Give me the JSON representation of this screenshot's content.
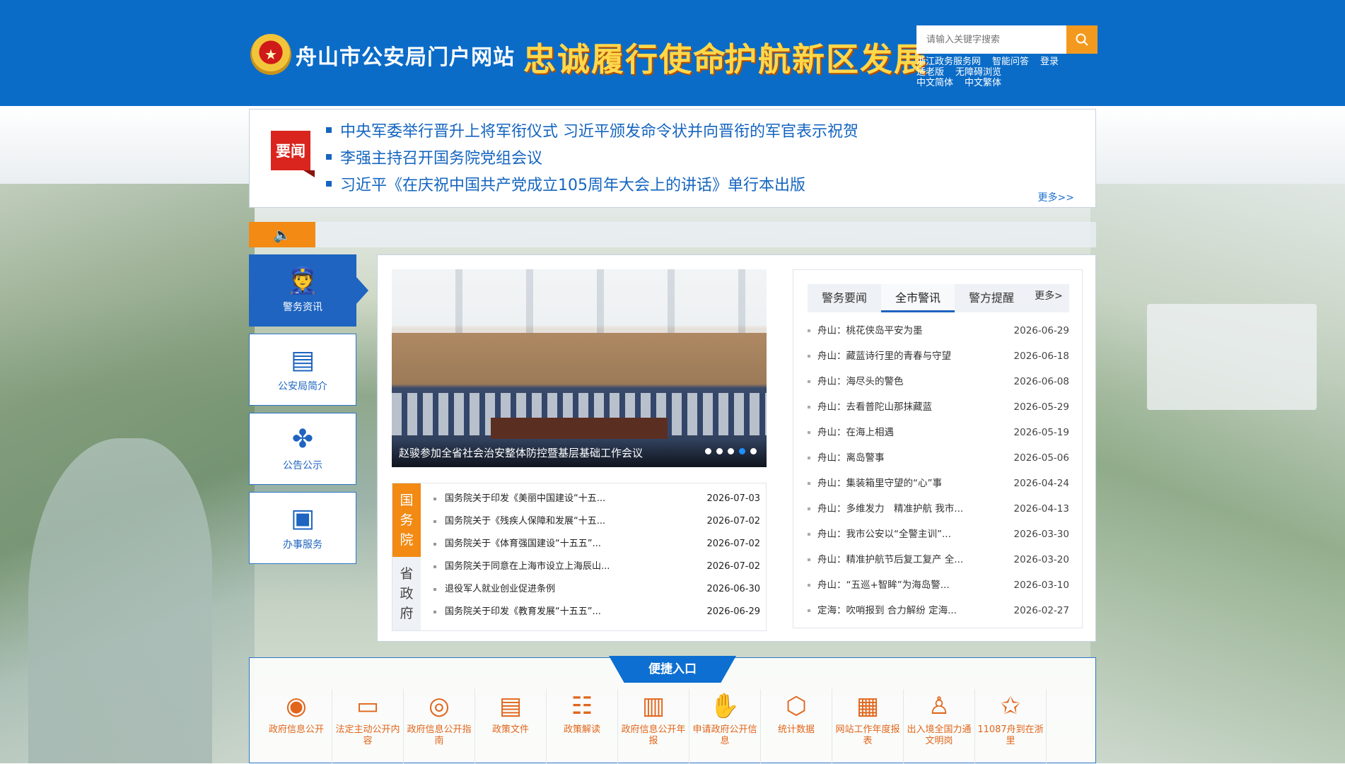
{
  "header": {
    "emblem_glyph": "★",
    "site_title": "舟山市公安局门户网站",
    "slogan_left": "忠诚履行使命",
    "slogan_right": "护航新区发展",
    "search_placeholder": "请输入关键字搜索",
    "search_icon": "magnifier-icon",
    "links": [
      "浙江政务服务网",
      "智能问答",
      "登录",
      "适老版",
      "无障碍浏览",
      "中文简体",
      "中文繁体"
    ]
  },
  "headline_news": {
    "tag": "要闻",
    "items": [
      "中央军委举行晋升上将军衔仪式 习近平颁发命令状并向晋衔的军官表示祝贺",
      "李强主持召开国务院党组会议",
      "习近平《在庆祝中国共产党成立105周年大会上的讲话》单行本出版"
    ],
    "more": "更多>>"
  },
  "notice": {
    "icon": "speaker-icon",
    "glyph": "🔈"
  },
  "side_nav": [
    {
      "label": "警务资讯",
      "glyph": "👮"
    },
    {
      "label": "公安局简介",
      "glyph": "▤"
    },
    {
      "label": "公告公示",
      "glyph": "✤"
    },
    {
      "label": "办事服务",
      "glyph": "▣"
    }
  ],
  "carousel": {
    "caption": "赵骏参加全省社会治安整体防控暨基层基础工作会议",
    "slide_count": 5,
    "active_index": 3
  },
  "gov_docs": {
    "tab_state_council": "国务院",
    "tab_province": "省政府",
    "items": [
      {
        "title": "国务院关于印发《美丽中国建设“十五...",
        "date": "2026-07-03"
      },
      {
        "title": "国务院关于《残疾人保障和发展“十五...",
        "date": "2026-07-02"
      },
      {
        "title": "国务院关于《体育强国建设“十五五”...",
        "date": "2026-07-02"
      },
      {
        "title": "国务院关于同意在上海市设立上海辰山...",
        "date": "2026-07-02"
      },
      {
        "title": "退役军人就业创业促进条例",
        "date": "2026-06-30"
      },
      {
        "title": "国务院关于印发《教育发展“十五五”...",
        "date": "2026-06-29"
      }
    ]
  },
  "police_news": {
    "tabs": [
      "警务要闻",
      "全市警讯",
      "警方提醒"
    ],
    "active_tab": 1,
    "more": "更多>",
    "items": [
      {
        "title": "舟山：桃花侠岛平安为墨",
        "date": "2026-06-29"
      },
      {
        "title": "舟山：藏蓝诗行里的青春与守望",
        "date": "2026-06-18"
      },
      {
        "title": "舟山：海尽头的警色",
        "date": "2026-06-08"
      },
      {
        "title": "舟山：去看普陀山那抹藏蓝",
        "date": "2026-05-29"
      },
      {
        "title": "舟山：在海上相遇",
        "date": "2026-05-19"
      },
      {
        "title": "舟山：离岛警事",
        "date": "2026-05-06"
      },
      {
        "title": "舟山：集装箱里守望的“心”事",
        "date": "2026-04-24"
      },
      {
        "title": "舟山：多维发力　精准护航 我市...",
        "date": "2026-04-13"
      },
      {
        "title": "舟山：我市公安以“全警主训”...",
        "date": "2026-03-30"
      },
      {
        "title": "舟山：精准护航节后复工复产 全...",
        "date": "2026-03-20"
      },
      {
        "title": "舟山：“五巡+智眸”为海岛警...",
        "date": "2026-03-10"
      },
      {
        "title": "定海：吹哨报到 合力解纷 定海...",
        "date": "2026-02-27"
      }
    ]
  },
  "quick_access": {
    "title": "便捷入口",
    "items": [
      {
        "label": "政府信息公开",
        "glyph": "◉"
      },
      {
        "label": "法定主动公开内容",
        "glyph": "▭"
      },
      {
        "label": "政府信息公开指南",
        "glyph": "◎"
      },
      {
        "label": "政策文件",
        "glyph": "▤"
      },
      {
        "label": "政策解读",
        "glyph": "☷"
      },
      {
        "label": "政府信息公开年报",
        "glyph": "▥"
      },
      {
        "label": "申请政府公开信息",
        "glyph": "✋"
      },
      {
        "label": "统计数据",
        "glyph": "⬡"
      },
      {
        "label": "网站工作年度报表",
        "glyph": "▦"
      },
      {
        "label": "出入境全国力通文明岗",
        "glyph": "♙"
      },
      {
        "label": "11087舟到在浙里",
        "glyph": "✩"
      }
    ]
  },
  "colors": {
    "header_blue": "#0b6cc8",
    "accent_orange": "#f28a13",
    "news_blue": "#1565c0",
    "slogan_gold": "#ffd84a"
  }
}
